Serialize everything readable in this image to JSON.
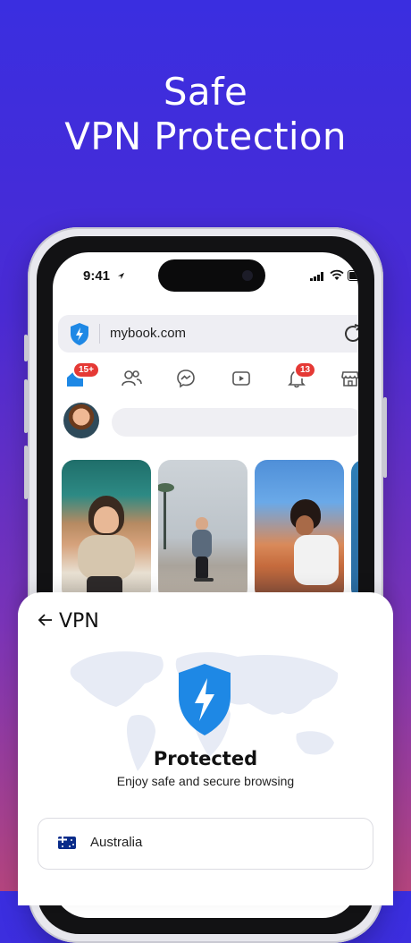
{
  "headline": {
    "line1": "Safe",
    "line2": "VPN Protection"
  },
  "status_bar": {
    "time": "9:41"
  },
  "browser": {
    "url": "mybook.com"
  },
  "nav": {
    "home_badge": "15+",
    "notifications_badge": "13"
  },
  "vpn": {
    "title": "VPN",
    "status": "Protected",
    "subtitle": "Enjoy safe and secure browsing",
    "location": "Australia"
  },
  "colors": {
    "accent_blue": "#1e88e5",
    "badge_red": "#e53935",
    "bg_top": "#3a2ee0",
    "bg_bottom": "#b4457e"
  },
  "icons": [
    "shield-icon",
    "reload-icon",
    "home-icon",
    "friends-icon",
    "messenger-icon",
    "video-icon",
    "bell-icon",
    "store-icon",
    "back-arrow-icon",
    "world-map",
    "flag-au-icon"
  ]
}
